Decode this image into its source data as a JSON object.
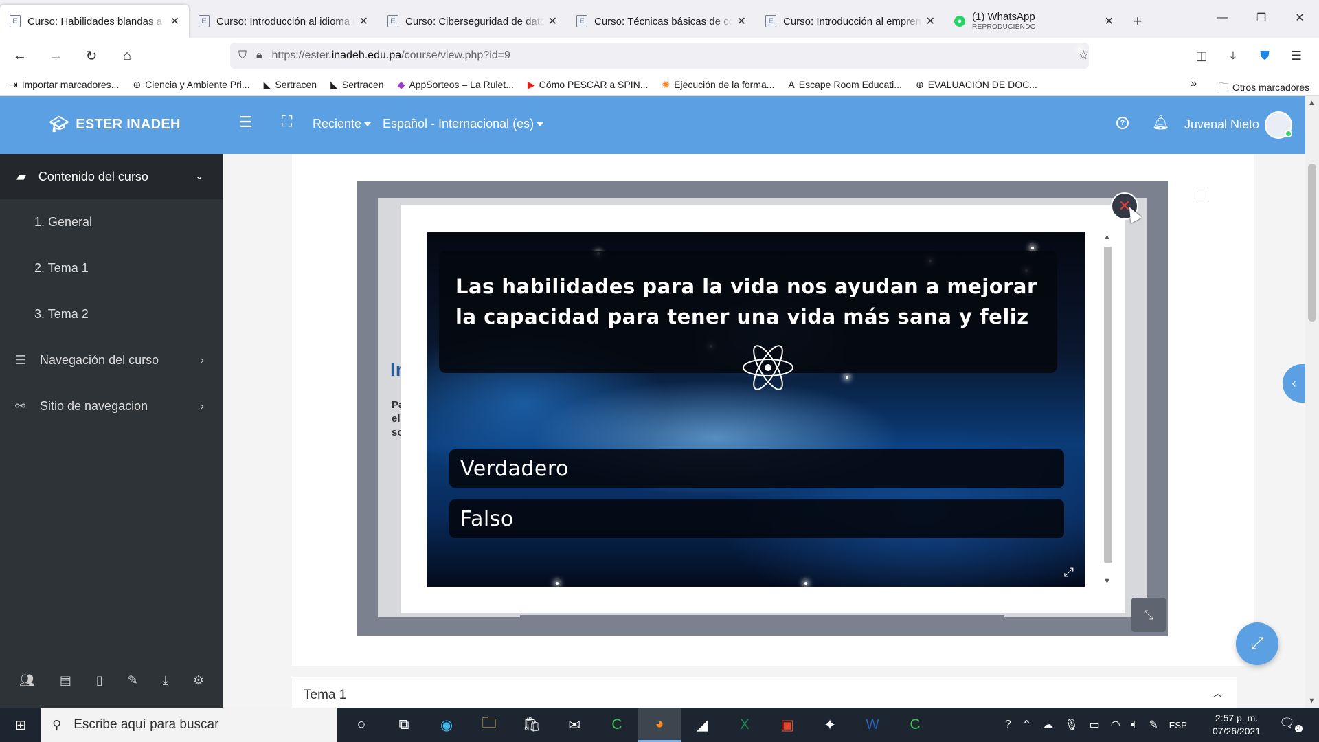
{
  "browser": {
    "tabs": [
      {
        "title": "Curso: Habilidades blandas a n",
        "active": true
      },
      {
        "title": "Curso: Introducción al idioma in",
        "active": false
      },
      {
        "title": "Curso: Ciberseguridad de datos",
        "active": false
      },
      {
        "title": "Curso: Técnicas básicas de coc",
        "active": false
      },
      {
        "title": "Curso: Introducción al empren",
        "active": false
      }
    ],
    "whatsapp_tab": {
      "title": "(1) WhatsApp",
      "status": "REPRODUCIENDO"
    },
    "url_prefix": "https://ester.",
    "url_host": "inadeh.edu.pa",
    "url_path": "/course/view.php?id=9",
    "bookmarks": [
      "Importar marcadores...",
      "Ciencia y Ambiente Pri...",
      "Sertracen",
      "Sertracen",
      "AppSorteos – La Rulet...",
      "Cómo PESCAR a SPIN...",
      "Ejecución de la forma...",
      "Escape Room Educati...",
      "EVALUACIÓN DE DOC..."
    ],
    "other_bookmarks": "Otros marcadores"
  },
  "header": {
    "brand": "ESTER INADEH",
    "recent": "Reciente",
    "language": "Español - Internacional (es)",
    "user": "Juvenal Nieto",
    "help_glyph": "?"
  },
  "sidebar": {
    "course_content": "Contenido del curso",
    "sections": [
      "1.  General",
      "2.  Tema 1",
      "3.  Tema 2"
    ],
    "course_nav": "Navegación del curso",
    "site_nav": "Sitio de navegacion"
  },
  "content": {
    "partial_heading": "In",
    "partial_lines": [
      "Pa",
      "el",
      "so"
    ],
    "section_title": "Tema 1"
  },
  "quiz": {
    "question": "Las habilidades para la vida nos ayudan a mejorar la capacidad para tener una vida más sana y feliz",
    "answers": [
      "Verdadero",
      "Falso"
    ]
  },
  "taskbar": {
    "search_placeholder": "Escribe aquí para buscar",
    "lang": "ESP",
    "time": "2:57 p. m.",
    "date": "07/26/2021",
    "notifications": "3"
  },
  "colors": {
    "accent": "#5aa0e3",
    "sidebar": "#2e3338",
    "close": "#e53935"
  }
}
